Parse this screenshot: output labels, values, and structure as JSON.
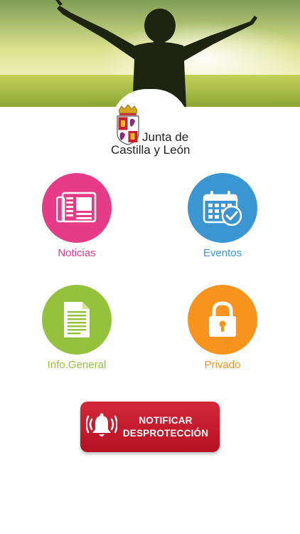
{
  "brand": {
    "line1": "Junta de",
    "line2": "Castilla y León"
  },
  "menu": [
    {
      "id": "noticias",
      "label": "Noticias",
      "color": "#e63b86",
      "icon": "newspaper-icon"
    },
    {
      "id": "eventos",
      "label": "Eventos",
      "color": "#3b95d1",
      "icon": "calendar-check-icon"
    },
    {
      "id": "info-general",
      "label": "Info.General",
      "color": "#95c23d",
      "icon": "document-icon"
    },
    {
      "id": "privado",
      "label": "Privado",
      "color": "#f7941d",
      "icon": "padlock-icon"
    }
  ],
  "alert_button": {
    "line1": "NOTIFICAR",
    "line2": "DESPROTECCIÓN",
    "color": "#c41a2c",
    "icon": "bell-icon"
  }
}
